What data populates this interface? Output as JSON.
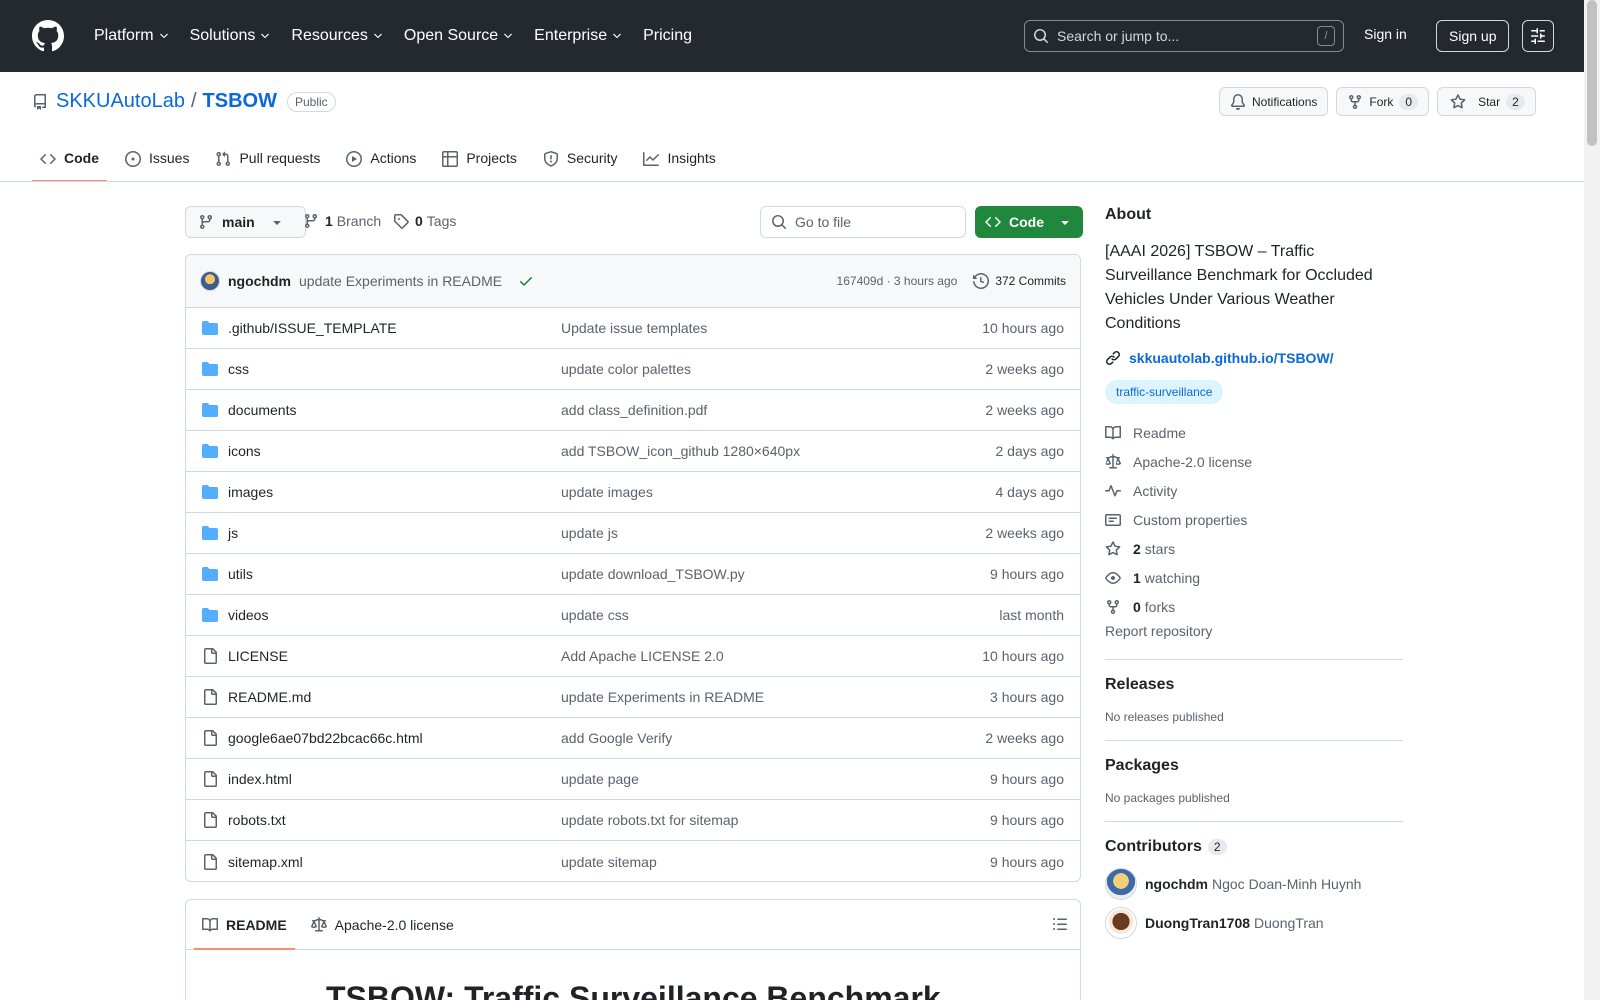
{
  "topbar": {
    "nav": [
      {
        "label": "Platform"
      },
      {
        "label": "Solutions"
      },
      {
        "label": "Resources"
      },
      {
        "label": "Open Source"
      },
      {
        "label": "Enterprise"
      },
      {
        "label": "Pricing"
      }
    ],
    "search_placeholder": "Search or jump to...",
    "search_shortcut": "/",
    "signin": "Sign in",
    "signup": "Sign up"
  },
  "repo": {
    "owner": "SKKUAutoLab",
    "separator": "/",
    "name": "TSBOW",
    "visibility": "Public",
    "notifications_label": "Notifications",
    "fork_label": "Fork",
    "fork_count": "0",
    "star_label": "Star",
    "star_count": "2"
  },
  "tabs": [
    {
      "label": "Code",
      "icon": "code-icon"
    },
    {
      "label": "Issues",
      "icon": "issue-icon"
    },
    {
      "label": "Pull requests",
      "icon": "pull-request-icon"
    },
    {
      "label": "Actions",
      "icon": "play-icon"
    },
    {
      "label": "Projects",
      "icon": "table-icon"
    },
    {
      "label": "Security",
      "icon": "shield-icon"
    },
    {
      "label": "Insights",
      "icon": "graph-icon"
    }
  ],
  "filenav": {
    "branch": "main",
    "branch_count": "1",
    "branch_label": "Branch",
    "tag_count": "0",
    "tag_label": "Tags",
    "goto_placeholder": "Go to file",
    "code_button": "Code"
  },
  "latest_commit": {
    "author": "ngochdm",
    "message": "update Experiments in README",
    "hash_time": "167409d · 3 hours ago",
    "commits": "372 Commits"
  },
  "files": [
    {
      "name": ".github/ISSUE_TEMPLATE",
      "type": "folder",
      "message": "Update issue templates",
      "date": "10 hours ago"
    },
    {
      "name": "css",
      "type": "folder",
      "message": "update color palettes",
      "date": "2 weeks ago"
    },
    {
      "name": "documents",
      "type": "folder",
      "message": "add class_definition.pdf",
      "date": "2 weeks ago"
    },
    {
      "name": "icons",
      "type": "folder",
      "message": "add TSBOW_icon_github 1280×640px",
      "date": "2 days ago"
    },
    {
      "name": "images",
      "type": "folder",
      "message": "update images",
      "date": "4 days ago"
    },
    {
      "name": "js",
      "type": "folder",
      "message": "update js",
      "date": "2 weeks ago"
    },
    {
      "name": "utils",
      "type": "folder",
      "message": "update download_TSBOW.py",
      "date": "9 hours ago"
    },
    {
      "name": "videos",
      "type": "folder",
      "message": "update css",
      "date": "last month"
    },
    {
      "name": "LICENSE",
      "type": "file",
      "message": "Add Apache LICENSE 2.0",
      "date": "10 hours ago"
    },
    {
      "name": "README.md",
      "type": "file",
      "message": "update Experiments in README",
      "date": "3 hours ago"
    },
    {
      "name": "google6ae07bd22bcac66c.html",
      "type": "file",
      "message": "add Google Verify",
      "date": "2 weeks ago"
    },
    {
      "name": "index.html",
      "type": "file",
      "message": "update page",
      "date": "9 hours ago"
    },
    {
      "name": "robots.txt",
      "type": "file",
      "message": "update robots.txt for sitemap",
      "date": "9 hours ago"
    },
    {
      "name": "sitemap.xml",
      "type": "file",
      "message": "update sitemap",
      "date": "9 hours ago"
    }
  ],
  "readme": {
    "tab_readme": "README",
    "tab_license": "Apache-2.0 license",
    "heading": "TSBOW: Traffic Surveillance Benchmark"
  },
  "sidebar": {
    "about_title": "About",
    "description": "[AAAI 2026] TSBOW – Traffic Surveillance Benchmark for Occluded Vehicles Under Various Weather Conditions",
    "website": "skkuautolab.github.io/TSBOW/",
    "topic": "traffic-surveillance",
    "readme": "Readme",
    "license": "Apache-2.0 license",
    "activity": "Activity",
    "custom_properties": "Custom properties",
    "stars_count": "2",
    "stars_label": "stars",
    "watching_count": "1",
    "watching_label": "watching",
    "forks_count": "0",
    "forks_label": "forks",
    "report": "Report repository",
    "releases_title": "Releases",
    "releases_text": "No releases published",
    "packages_title": "Packages",
    "packages_text": "No packages published",
    "contributors_title": "Contributors",
    "contributors_count": "2",
    "contributors": [
      {
        "login": "ngochdm",
        "name": "Ngoc Doan-Minh Huynh"
      },
      {
        "login": "DuongTran1708",
        "name": "DuongTran"
      }
    ]
  },
  "colors": {
    "header_bg": "#24292f",
    "link": "#0969da",
    "primary_button": "#1f883d",
    "active_tab_underline": "#fd8c73",
    "folder_icon": "#54aeff"
  }
}
